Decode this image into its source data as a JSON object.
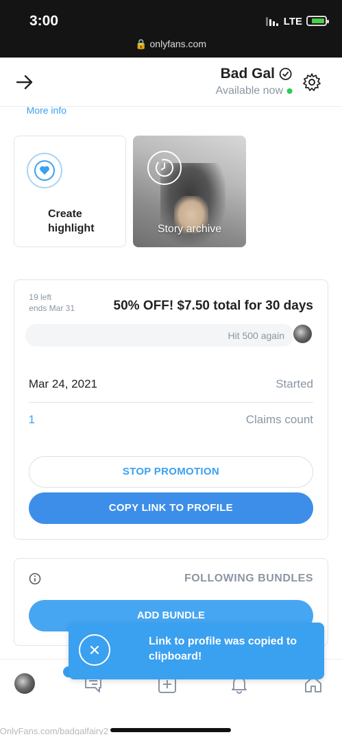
{
  "status_bar": {
    "time": "3:00",
    "network": "LTE",
    "url": "onlyfans.com"
  },
  "header": {
    "name": "Bad Gal",
    "status": "Available now",
    "more_info": "More info"
  },
  "highlights": {
    "create_label": "Create highlight",
    "archive_label": "Story archive"
  },
  "promotion": {
    "title": "50% OFF! $7.50 total for 30 days",
    "left": "19 left",
    "ends": "ends Mar 31",
    "message": "Hit 500 again",
    "rows": [
      {
        "label": "Started",
        "value": "Mar 24, 2021"
      },
      {
        "label": "Claims count",
        "value": "1"
      }
    ],
    "stop_button": "STOP PROMOTION",
    "copy_button": "COPY LINK TO PROFILE"
  },
  "bundles": {
    "title": "FOLLOWING BUNDLES",
    "add_button": "ADD BUNDLE"
  },
  "toast": {
    "message": "Link to profile was copied to clipboard!"
  },
  "footer": {
    "url": "OnlyFans.com/badgalfairy2"
  },
  "colors": {
    "accent": "#3aa0f0",
    "button": "#3d8ee8",
    "online": "#2fca5a",
    "muted": "#8a96a3"
  },
  "icons": [
    "back-arrow-icon",
    "verified-icon",
    "gear-icon",
    "highlight-heart-icon",
    "clock-icon",
    "info-icon",
    "close-icon",
    "home-icon",
    "bell-icon",
    "plus-icon",
    "messages-icon"
  ]
}
